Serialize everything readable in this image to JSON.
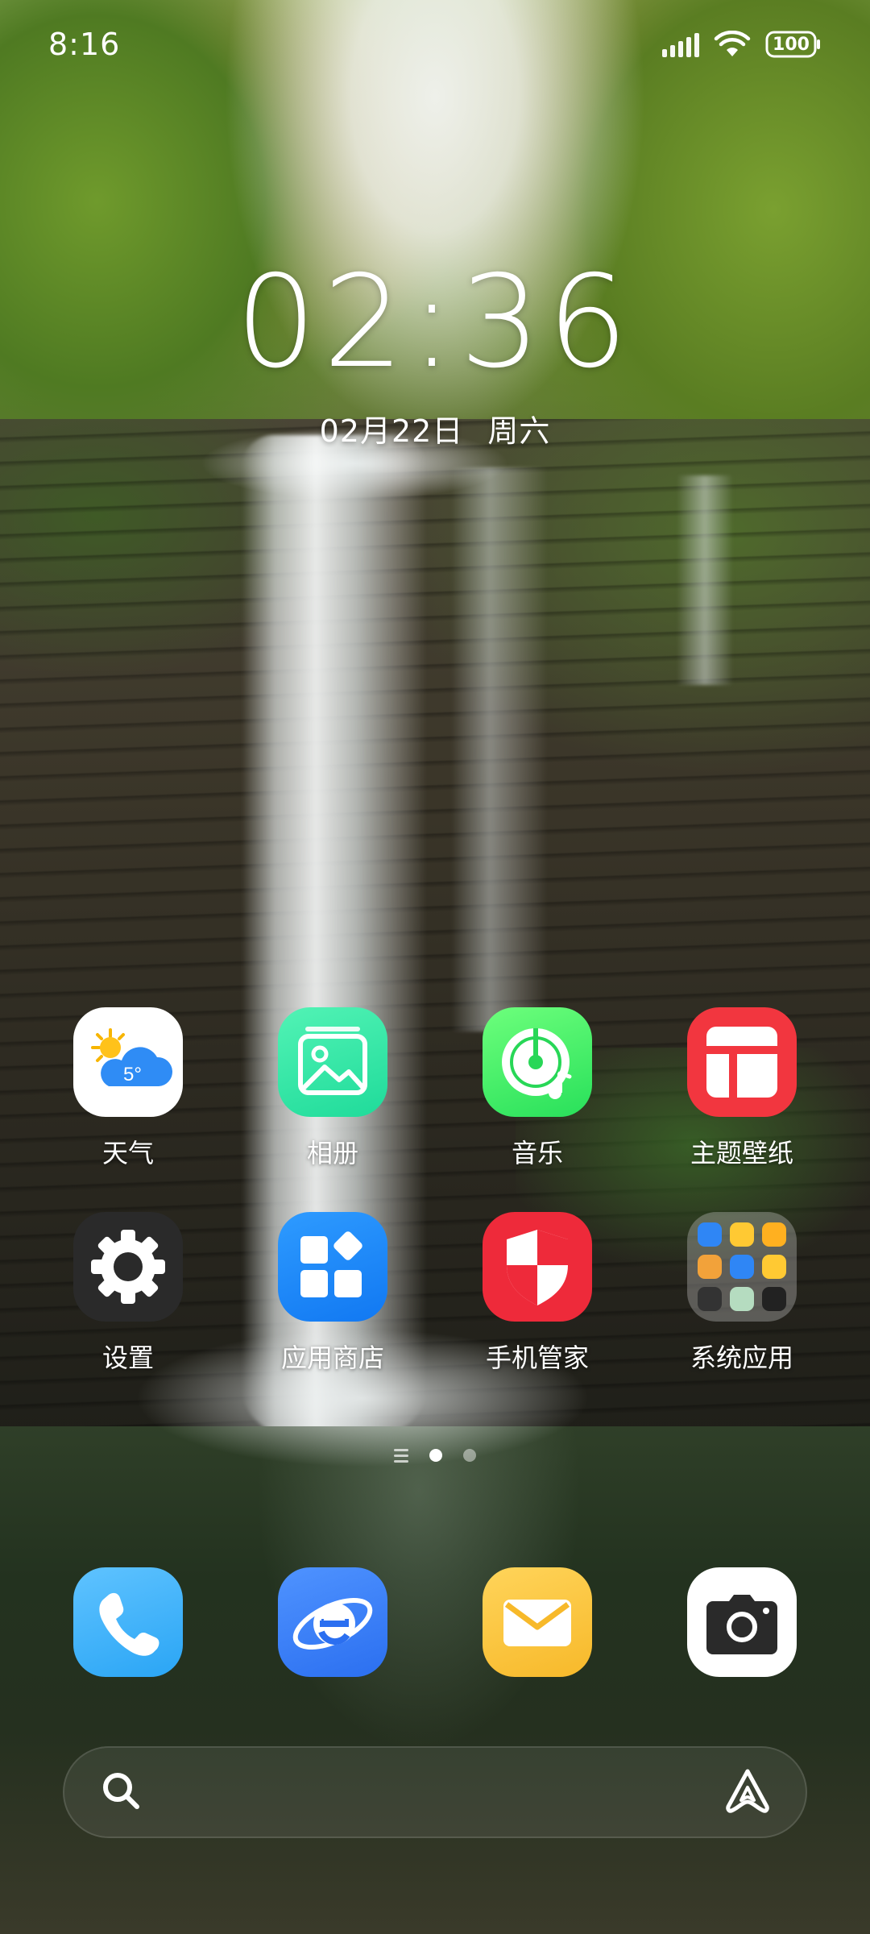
{
  "status_bar": {
    "time": "8:16",
    "battery": "100",
    "icons": [
      "signal-icon",
      "wifi-icon",
      "battery-icon"
    ]
  },
  "clock": {
    "time": "02:36",
    "date": "02月22日",
    "weekday": "周六"
  },
  "apps": [
    {
      "label": "天气",
      "icon": "weather-icon",
      "badge_text": "5°"
    },
    {
      "label": "相册",
      "icon": "gallery-icon"
    },
    {
      "label": "音乐",
      "icon": "music-icon"
    },
    {
      "label": "主题壁纸",
      "icon": "theme-icon"
    },
    {
      "label": "设置",
      "icon": "gear-icon"
    },
    {
      "label": "应用商店",
      "icon": "app-store-icon"
    },
    {
      "label": "手机管家",
      "icon": "shield-icon"
    },
    {
      "label": "系统应用",
      "icon": "folder-icon"
    }
  ],
  "page_indicator": {
    "pages": 2,
    "current": 1
  },
  "dock": [
    {
      "icon": "phone-icon"
    },
    {
      "icon": "browser-icon"
    },
    {
      "icon": "mail-icon"
    },
    {
      "icon": "camera-icon"
    }
  ],
  "search_bar": {
    "icons": [
      "search-icon",
      "assistant-icon"
    ]
  },
  "colors": {
    "weather_bg": "#ffffff",
    "gallery": "#2fe6a4",
    "music": "#3cec66",
    "theme": "#f2363f",
    "settings": "#2a2a2a",
    "store": "#1f88f7",
    "security": "#ee2a3a",
    "phone": "#3fb3f8",
    "browser": "#3a80f5",
    "mail": "#f9c33c",
    "camera_bg": "#ffffff"
  }
}
